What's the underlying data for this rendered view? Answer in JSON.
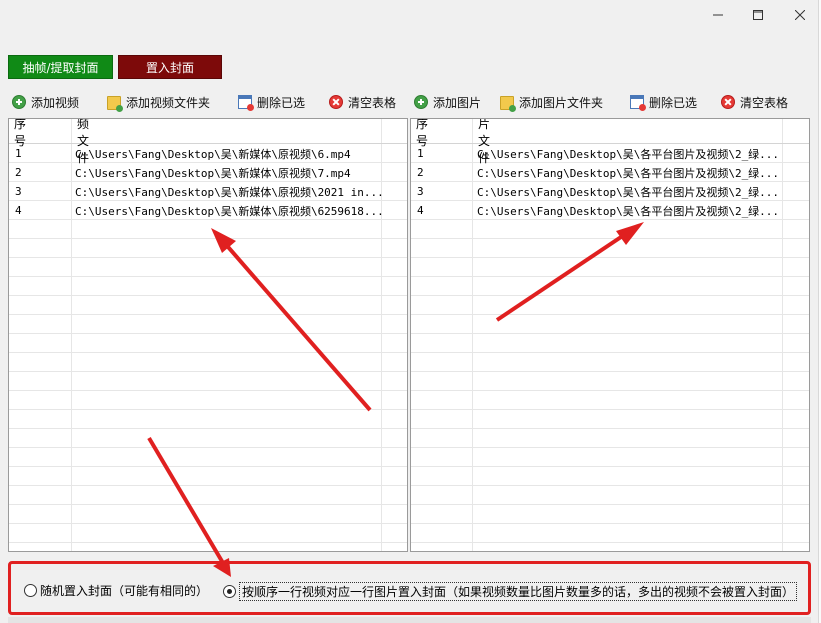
{
  "window": {
    "minimize_icon": "minimize-icon",
    "maximize_icon": "maximize-icon",
    "close_icon": "close-icon"
  },
  "modes": {
    "extract_label": "抽帧/提取封面",
    "insert_label": "置入封面",
    "extract_color": "#108a16",
    "insert_color": "#7d0a0a"
  },
  "video_toolbar": {
    "add_label": "添加视频",
    "add_folder_label": "添加视频文件夹",
    "delete_selected_label": "删除已选",
    "clear_label": "清空表格"
  },
  "image_toolbar": {
    "add_label": "添加图片",
    "add_folder_label": "添加图片文件夹",
    "delete_selected_label": "删除已选",
    "clear_label": "清空表格"
  },
  "video_table": {
    "columns": [
      "序号",
      "视频文件"
    ],
    "rows": [
      [
        "1",
        "C:\\Users\\Fang\\Desktop\\吴\\新媒体\\原视频\\6.mp4"
      ],
      [
        "2",
        "C:\\Users\\Fang\\Desktop\\吴\\新媒体\\原视频\\7.mp4"
      ],
      [
        "3",
        "C:\\Users\\Fang\\Desktop\\吴\\新媒体\\原视频\\2021 in..."
      ],
      [
        "4",
        "C:\\Users\\Fang\\Desktop\\吴\\新媒体\\原视频\\6259618..."
      ]
    ]
  },
  "image_table": {
    "columns": [
      "序号",
      "图片文件"
    ],
    "rows": [
      [
        "1",
        "C:\\Users\\Fang\\Desktop\\吴\\各平台图片及视频\\2_绿..."
      ],
      [
        "2",
        "C:\\Users\\Fang\\Desktop\\吴\\各平台图片及视频\\2_绿..."
      ],
      [
        "3",
        "C:\\Users\\Fang\\Desktop\\吴\\各平台图片及视频\\2_绿..."
      ],
      [
        "4",
        "C:\\Users\\Fang\\Desktop\\吴\\各平台图片及视频\\2_绿..."
      ]
    ]
  },
  "options": {
    "random_label": "随机置入封面（可能有相同的）",
    "sequential_label": "按顺序一行视频对应一行图片置入封面（如果视频数量比图片数量多的话，多出的视频不会被置入封面）",
    "selected": "sequential"
  },
  "annotation_color": "#e02020"
}
